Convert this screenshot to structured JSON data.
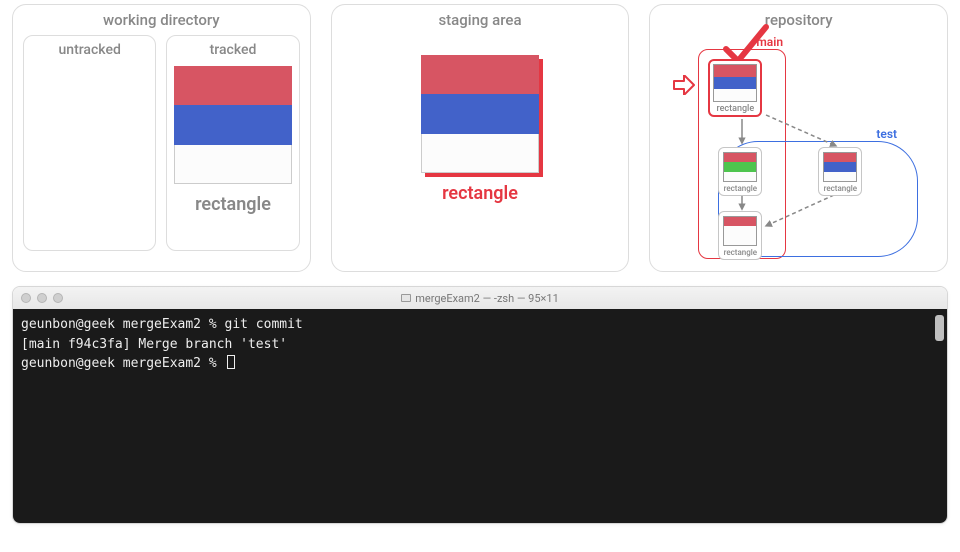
{
  "colors": {
    "red": "#d75563",
    "blue": "#4262c9",
    "white": "#fcfcfc",
    "green": "#4ec54e",
    "accentRed": "#e53742",
    "accentBlue": "#3d6fe0"
  },
  "panels": {
    "working": {
      "title": "working directory",
      "untracked": {
        "title": "untracked"
      },
      "tracked": {
        "title": "tracked",
        "file": {
          "label": "rectangle",
          "stripes": [
            "red",
            "blue",
            "white"
          ]
        }
      }
    },
    "staging": {
      "title": "staging area",
      "file": {
        "label": "rectangle",
        "stripes": [
          "red",
          "blue",
          "white"
        ],
        "highlighted": true
      }
    },
    "repo": {
      "title": "repository",
      "branches": {
        "main": "main",
        "test": "test"
      },
      "commits": {
        "head": {
          "label": "rectangle",
          "stripes": [
            "red",
            "blue",
            "white"
          ],
          "isHead": true
        },
        "mainPrev": {
          "label": "rectangle",
          "stripes": [
            "red",
            "green",
            "white"
          ]
        },
        "testTip": {
          "label": "rectangle",
          "stripes": [
            "red",
            "blue",
            "white"
          ]
        },
        "base": {
          "label": "rectangle",
          "stripes": [
            "red",
            "white",
            "white"
          ]
        }
      }
    }
  },
  "terminal": {
    "title": "mergeExam2 — -zsh — 95×11",
    "lines": [
      "geunbon@geek mergeExam2 % git commit",
      "[main f94c3fa] Merge branch 'test'",
      "geunbon@geek mergeExam2 % "
    ]
  }
}
